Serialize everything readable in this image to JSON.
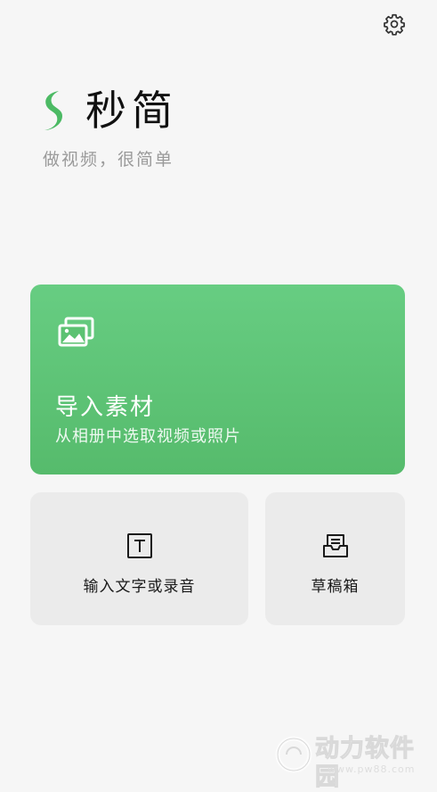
{
  "app": {
    "title": "秒简",
    "tagline": "做视频，很简单"
  },
  "header": {
    "settings_icon": "gear-icon"
  },
  "import_card": {
    "title": "导入素材",
    "subtitle": "从相册中选取视频或照片",
    "icon": "photo-stack-icon",
    "color": "#5fc477"
  },
  "tiles": [
    {
      "label": "输入文字或录音",
      "icon": "text-box-icon"
    },
    {
      "label": "草稿箱",
      "icon": "draft-tray-icon"
    }
  ],
  "watermark": {
    "brand": "动力软件园",
    "url": "www.pw88.com"
  },
  "colors": {
    "background": "#f6f6f6",
    "accent_green": "#5fc477",
    "tile_background": "#ebebeb",
    "muted_text": "#9a9a9a"
  }
}
